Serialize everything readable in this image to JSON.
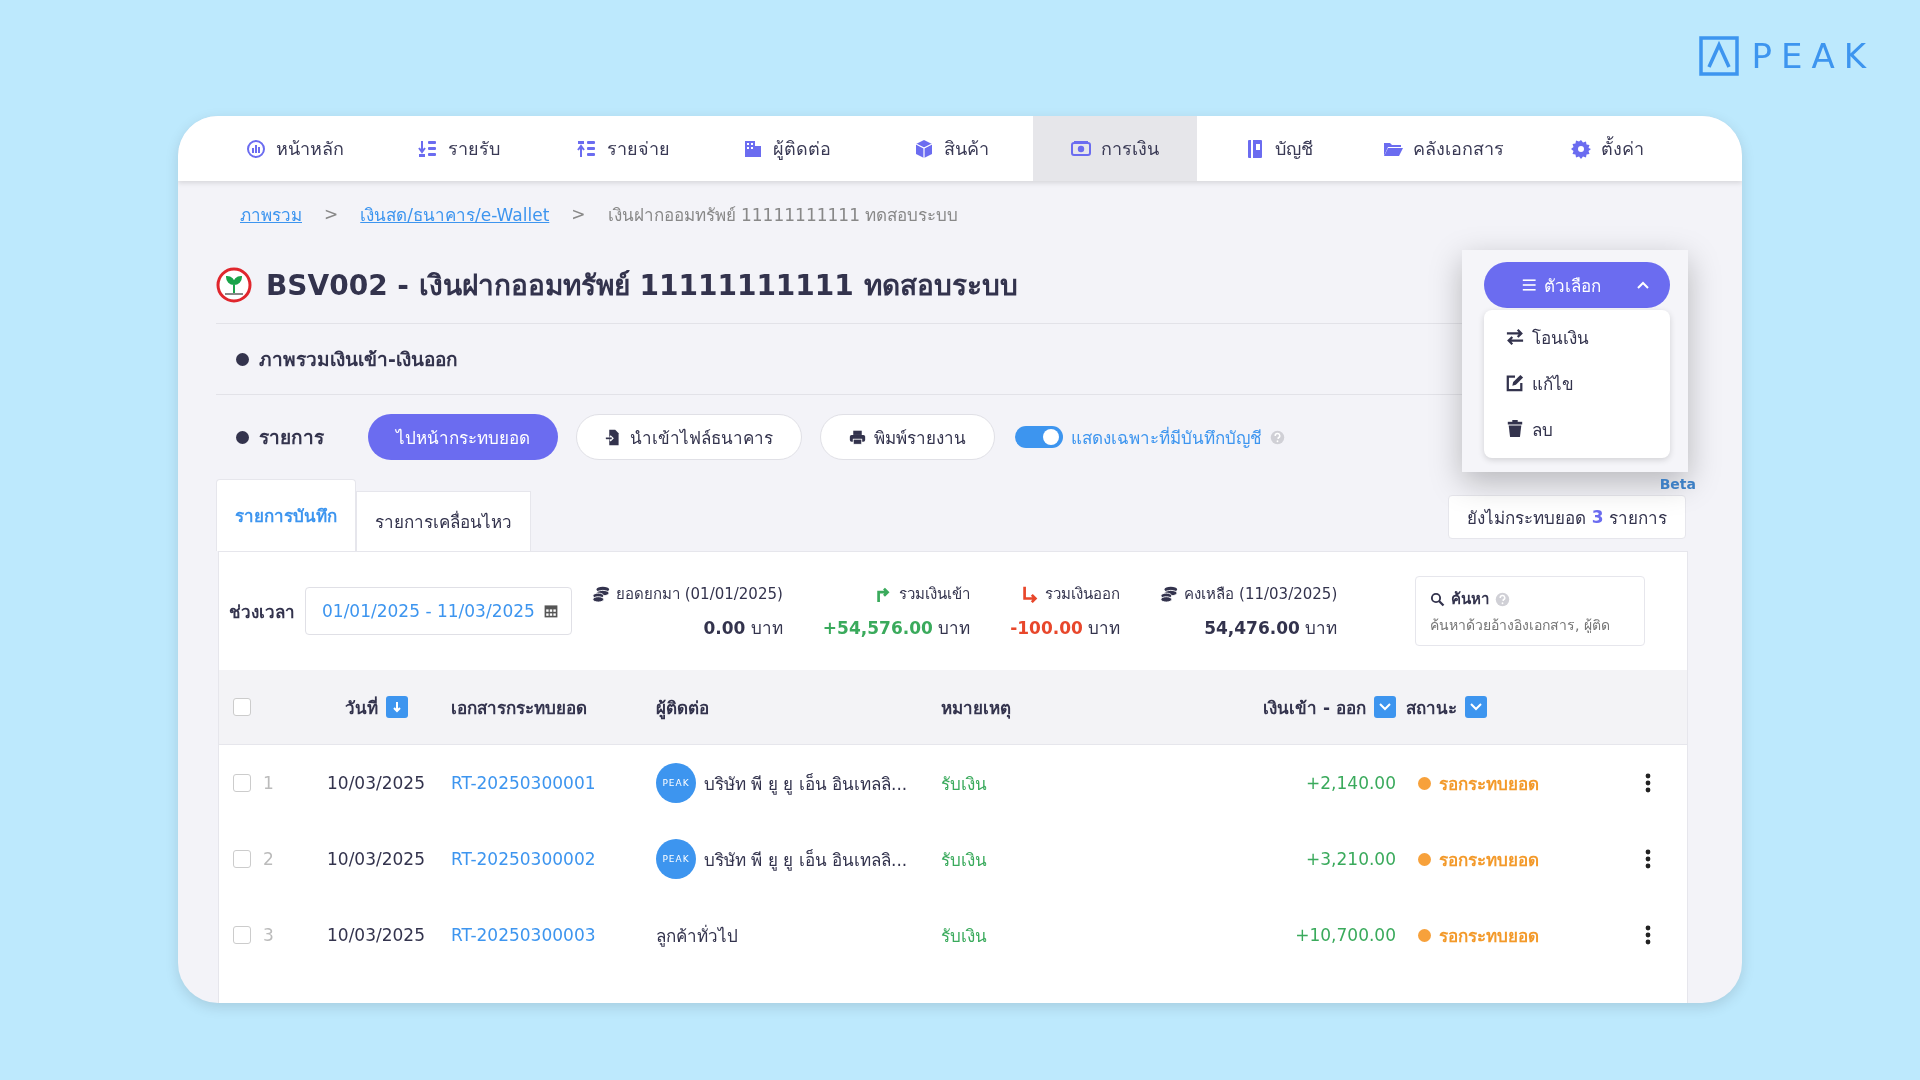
{
  "logo": {
    "text": "PEAK"
  },
  "nav": [
    {
      "label": "หน้าหลัก",
      "selected": false
    },
    {
      "label": "รายรับ",
      "selected": false
    },
    {
      "label": "รายจ่าย",
      "selected": false
    },
    {
      "label": "ผู้ติดต่อ",
      "selected": false
    },
    {
      "label": "สินค้า",
      "selected": false
    },
    {
      "label": "การเงิน",
      "selected": true
    },
    {
      "label": "บัญชี",
      "selected": false
    },
    {
      "label": "คลังเอกสาร",
      "selected": false
    },
    {
      "label": "ตั้งค่า",
      "selected": false
    }
  ],
  "breadcrumb": [
    {
      "label": "ภาพรวม",
      "kind": "link"
    },
    {
      "label": ">",
      "kind": "separator"
    },
    {
      "label": "เงินสด/ธนาคาร/e-Wallet",
      "kind": "link"
    },
    {
      "label": ">",
      "kind": "separator"
    },
    {
      "label": "เงินฝากออมทรัพย์ 11111111111 ทดสอบระบบ",
      "kind": "current"
    }
  ],
  "title": "BSV002 - เงินฝากออมทรัพย์ 11111111111 ทดสอบระบบ",
  "overview_label": "ภาพรวมเงินเข้า-เงินออก",
  "list_label": "รายการ",
  "actions": [
    {
      "label": "ไปหน้ากระทบยอด",
      "kind": "primary"
    },
    {
      "label": "นำเข้าไฟล์ธนาคาร",
      "kind": "import"
    },
    {
      "label": "พิมพ์รายงาน",
      "kind": "print"
    }
  ],
  "toggle": {
    "label": "แสดงเฉพาะที่มีบันทึกบัญชี",
    "on": true
  },
  "tabs": [
    {
      "label": "รายการบันทึก",
      "selected": true
    },
    {
      "label": "รายการเคลื่อนไหว",
      "selected": false
    }
  ],
  "unreconciled": {
    "prefix": "ยังไม่กระทบยอด",
    "count": "3",
    "suffix": "รายการ"
  },
  "options_menu": {
    "label": "ตัวเลือก",
    "expanded": true,
    "items": [
      {
        "label": "โอนเงิน"
      },
      {
        "label": "แก้ไข"
      },
      {
        "label": "ลบ"
      }
    ],
    "beta": "Beta"
  },
  "period": {
    "label": "ช่วงเวลา",
    "value": "01/01/2025 - 11/03/2025"
  },
  "summary": [
    {
      "label": "ยอดยกมา (01/01/2025)",
      "amount": "0.00",
      "unit": "บาท",
      "kind": "balance"
    },
    {
      "label": "รวมเงินเข้า",
      "amount": "+54,576.00",
      "unit": "บาท",
      "kind": "in"
    },
    {
      "label": "รวมเงินออก",
      "amount": "-100.00",
      "unit": "บาท",
      "kind": "out"
    },
    {
      "label": "คงเหลือ (11/03/2025)",
      "amount": "54,476.00",
      "unit": "บาท",
      "kind": "balance"
    }
  ],
  "search": {
    "label": "ค้นหา",
    "placeholder": "ค้นหาด้วยอ้างอิงเอกสาร, ผู้ติด"
  },
  "select_all": {
    "checked": false
  },
  "columns": [
    {
      "label": "วันที่",
      "kind": "sort"
    },
    {
      "label": "เอกสารกระทบยอด",
      "kind": "plain"
    },
    {
      "label": "ผู้ติดต่อ",
      "kind": "plain"
    },
    {
      "label": "หมายเหตุ",
      "kind": "plain"
    },
    {
      "label": "เงินเข้า - ออก",
      "kind": "filter"
    },
    {
      "label": "สถานะ",
      "kind": "filter"
    }
  ],
  "rows": [
    {
      "index": "1",
      "checked": false,
      "date": "10/03/2025",
      "document": "RT-20250300001",
      "avatar": "PEAK",
      "contact": "บริษัท พี ยู ยู เอ็น อินเทลลิ...",
      "note": "รับเงิน",
      "amount": "+2,140.00",
      "status": "รอกระทบยอด"
    },
    {
      "index": "2",
      "checked": false,
      "date": "10/03/2025",
      "document": "RT-20250300002",
      "avatar": "PEAK",
      "contact": "บริษัท พี ยู ยู เอ็น อินเทลลิ...",
      "note": "รับเงิน",
      "amount": "+3,210.00",
      "status": "รอกระทบยอด"
    },
    {
      "index": "3",
      "checked": false,
      "date": "10/03/2025",
      "document": "RT-20250300003",
      "contact": "ลูกค้าทั่วไป",
      "note": "รับเงิน",
      "amount": "+10,700.00",
      "status": "รอกระทบยอด"
    }
  ]
}
